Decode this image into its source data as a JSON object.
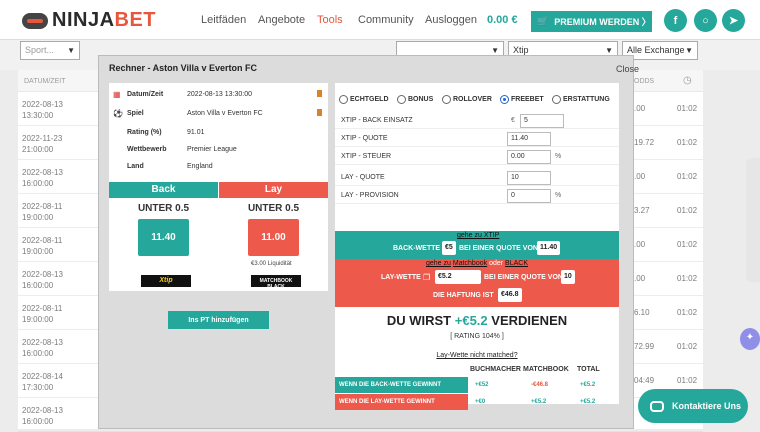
{
  "nav": {
    "brand_prefix": "NINJA",
    "brand_suffix": "BET",
    "links": [
      "Leitfäden",
      "Angebote",
      "Tools",
      "Community",
      "Ausloggen"
    ],
    "balance": "0.00 €",
    "premium": "PREMIUM WERDEN 〉",
    "accent": "#25a89b",
    "active_color": "#e8563c"
  },
  "filters": {
    "sport_placeholder": "Sport...",
    "xtip": "Xtip",
    "exchange": "Alle Exchange"
  },
  "table": {
    "headers": {
      "date": "DATUM/ZEIT",
      "odds": "ODDS"
    },
    "rows": [
      {
        "date": "2022-08-13",
        "time": "13:30:00",
        "val": ".00",
        "t": "01:02"
      },
      {
        "date": "2022-11-23",
        "time": "21:00:00",
        "val": "19.72",
        "t": "01:02"
      },
      {
        "date": "2022-08-13",
        "time": "16:00:00",
        "val": ".00",
        "t": "01:02"
      },
      {
        "date": "2022-08-11",
        "time": "19:00:00",
        "val": "3.27",
        "t": "01:02"
      },
      {
        "date": "2022-08-11",
        "time": "19:00:00",
        "val": ".00",
        "t": "01:02"
      },
      {
        "date": "2022-08-13",
        "time": "16:00:00",
        "val": ".00",
        "t": "01:02"
      },
      {
        "date": "2022-08-11",
        "time": "19:00:00",
        "val": "6.10",
        "t": "01:02"
      },
      {
        "date": "2022-08-13",
        "time": "16:00:00",
        "val": "72.99",
        "t": "01:02"
      },
      {
        "date": "2022-08-14",
        "time": "17:30:00",
        "val": "04:49",
        "t": "01:02"
      },
      {
        "date": "2022-08-13",
        "time": "16:00:00",
        "val": "",
        "t": ""
      }
    ]
  },
  "modal": {
    "title": "Rechner - Aston Villa v Everton FC",
    "close": "Close",
    "info": [
      {
        "key": "Datum/Zeit",
        "value": "2022-08-13 13:30:00",
        "icon": "calendar-icon"
      },
      {
        "key": "Spiel",
        "value": "Aston Villa v Everton FC",
        "icon": "football-icon"
      },
      {
        "key": "Rating (%)",
        "value": "91.01"
      },
      {
        "key": "Wettbewerb",
        "value": "Premier League"
      },
      {
        "key": "Land",
        "value": "England"
      }
    ],
    "back_label": "Back",
    "lay_label": "Lay",
    "back_market": "UNTER 0.5",
    "lay_market": "UNTER 0.5",
    "back_odds": "11.40",
    "lay_odds": "11.00",
    "liquidity": "€3.00 Liquidität",
    "xtip_logo": "Xtip",
    "mb_logo": "MATCHBOOK BLACK",
    "pt_button": "Ins PT hinzufügen"
  },
  "calc": {
    "types": [
      "ECHTGELD",
      "BONUS",
      "ROLLOVER",
      "FREEBET",
      "ERSTATTUNG"
    ],
    "selected_type": "FREEBET",
    "fields": [
      {
        "label": "XTIP - BACK EINSATZ",
        "prefix": "€",
        "value": "5",
        "suffix": ""
      },
      {
        "label": "XTIP - QUOTE",
        "prefix": "",
        "value": "11.40",
        "suffix": ""
      },
      {
        "label": "XTIP - STEUER",
        "prefix": "",
        "value": "0.00",
        "suffix": "%"
      },
      {
        "label": "LAY - QUOTE",
        "prefix": "",
        "value": "10",
        "suffix": ""
      },
      {
        "label": "LAY - PROVISION",
        "prefix": "",
        "value": "0",
        "suffix": "%"
      }
    ],
    "back_link": "gehe zu XTIP",
    "back_text1": "BACK-WETTE",
    "back_stake": "€5",
    "back_text2": "BEI EINER QUOTE VON",
    "back_odds": "11.40",
    "lay_link_1": "gehe zu",
    "lay_link_2": "Matchbook",
    "lay_link_3": "oder",
    "lay_link_4": "BLACK",
    "lay_text1": "LAY-WETTE",
    "lay_stake": "€5.2",
    "lay_text2": "BEI EINER QUOTE VON",
    "lay_odds": "10",
    "liability_text": "DIE HAFTUNG IST",
    "liability": "€46.8",
    "result_prefix": "DU WIRST",
    "result_value": "+€5.2",
    "result_suffix": "VERDIENEN",
    "rating": "[ RATING 104% ]",
    "not_matched": "Lay-Wette nicht matched?",
    "columns": [
      "BUCHMACHER",
      "MATCHBOOK",
      "TOTAL"
    ],
    "summary": [
      {
        "label": "WENN DIE BACK-WETTE GEWINNT",
        "bm": "+€52",
        "mb": "-€46.8",
        "total": "+€5.2"
      },
      {
        "label": "WENN DIE LAY-WETTE GEWINNT",
        "bm": "+€0",
        "mb": "+€5.2",
        "total": "+€5.2"
      }
    ]
  },
  "chat": {
    "label": "Kontaktiere Uns"
  }
}
